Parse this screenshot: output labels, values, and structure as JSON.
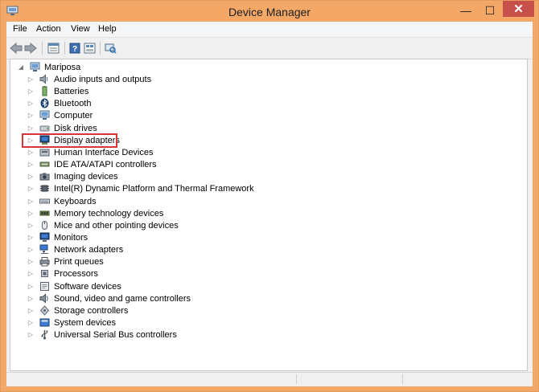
{
  "window": {
    "title": "Device Manager",
    "controls": {
      "minimize": "—",
      "maximize": "☐",
      "close": "✕"
    }
  },
  "menu": [
    {
      "label": "File"
    },
    {
      "label": "Action"
    },
    {
      "label": "View"
    },
    {
      "label": "Help"
    }
  ],
  "toolbar": [
    {
      "icon": "back-arrow-icon"
    },
    {
      "icon": "forward-arrow-icon"
    },
    {
      "icon": "properties-icon"
    },
    {
      "icon": "help-icon"
    },
    {
      "icon": "show-hidden-icon"
    },
    {
      "icon": "scan-hardware-icon"
    }
  ],
  "tree": {
    "root": {
      "label": "Mariposa",
      "expanded": true
    },
    "categories": [
      {
        "label": "Audio inputs and outputs",
        "icon": "speaker-icon"
      },
      {
        "label": "Batteries",
        "icon": "battery-icon"
      },
      {
        "label": "Bluetooth",
        "icon": "bluetooth-icon"
      },
      {
        "label": "Computer",
        "icon": "computer-icon"
      },
      {
        "label": "Disk drives",
        "icon": "disk-drive-icon"
      },
      {
        "label": "Display adapters",
        "icon": "display-adapter-icon",
        "highlighted": true
      },
      {
        "label": "Human Interface Devices",
        "icon": "hid-icon"
      },
      {
        "label": "IDE ATA/ATAPI controllers",
        "icon": "ide-controller-icon"
      },
      {
        "label": "Imaging devices",
        "icon": "camera-icon"
      },
      {
        "label": "Intel(R) Dynamic Platform and Thermal Framework",
        "icon": "chip-icon"
      },
      {
        "label": "Keyboards",
        "icon": "keyboard-icon"
      },
      {
        "label": "Memory technology devices",
        "icon": "memory-icon"
      },
      {
        "label": "Mice and other pointing devices",
        "icon": "mouse-icon"
      },
      {
        "label": "Monitors",
        "icon": "monitor-icon"
      },
      {
        "label": "Network adapters",
        "icon": "network-icon"
      },
      {
        "label": "Print queues",
        "icon": "printer-icon"
      },
      {
        "label": "Processors",
        "icon": "processor-icon"
      },
      {
        "label": "Software devices",
        "icon": "software-device-icon"
      },
      {
        "label": "Sound, video and game controllers",
        "icon": "sound-icon"
      },
      {
        "label": "Storage controllers",
        "icon": "storage-icon"
      },
      {
        "label": "System devices",
        "icon": "system-device-icon"
      },
      {
        "label": "Universal Serial Bus controllers",
        "icon": "usb-icon"
      }
    ]
  },
  "colors": {
    "frame": "#f3a868",
    "close_button": "#c7504a",
    "highlight_border": "#d8343a",
    "accent_blue": "#2f6fb3"
  }
}
